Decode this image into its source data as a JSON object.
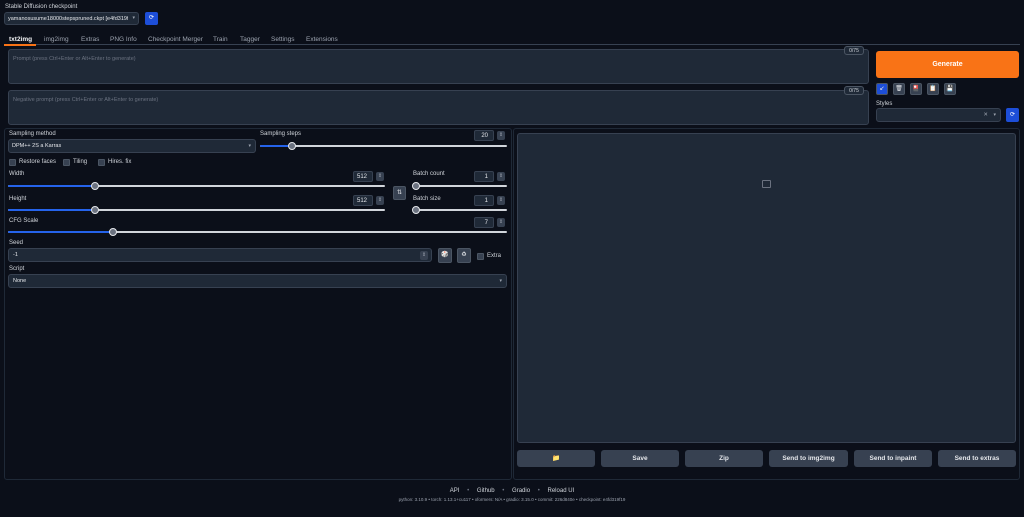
{
  "checkpoint": {
    "label": "Stable Diffusion checkpoint",
    "value": "yamanosusume18000stepspruned.ckpt [e4fd319f]"
  },
  "tabs": [
    "txt2img",
    "img2img",
    "Extras",
    "PNG Info",
    "Checkpoint Merger",
    "Train",
    "Tagger",
    "Settings",
    "Extensions"
  ],
  "prompt": {
    "placeholder": "Prompt (press Ctrl+Enter or Alt+Enter to generate)",
    "tokens": "0/75"
  },
  "negative_prompt": {
    "placeholder": "Negative prompt (press Ctrl+Enter or Alt+Enter to generate)",
    "tokens": "0/75"
  },
  "generate_label": "Generate",
  "styles_label": "Styles",
  "sampling_method": {
    "label": "Sampling method",
    "value": "DPM++ 2S a Karras"
  },
  "sampling_steps": {
    "label": "Sampling steps",
    "value": "20",
    "fraction": 0.13
  },
  "checkboxes": {
    "restore_faces": "Restore faces",
    "tiling": "Tiling",
    "hires_fix": "Hires. fix"
  },
  "width": {
    "label": "Width",
    "value": "512",
    "fraction": 0.23
  },
  "height": {
    "label": "Height",
    "value": "512",
    "fraction": 0.23
  },
  "batch_count": {
    "label": "Batch count",
    "value": "1",
    "fraction": 0.0
  },
  "batch_size": {
    "label": "Batch size",
    "value": "1",
    "fraction": 0.0
  },
  "cfg_scale": {
    "label": "CFG Scale",
    "value": "7",
    "fraction": 0.21
  },
  "seed": {
    "label": "Seed",
    "value": "-1",
    "extra_label": "Extra"
  },
  "script": {
    "label": "Script",
    "value": "None"
  },
  "output_buttons": [
    "Save",
    "Zip",
    "Send to img2img",
    "Send to inpaint",
    "Send to extras"
  ],
  "footer": {
    "links": [
      "API",
      "Github",
      "Gradio",
      "Reload UI"
    ],
    "sep": "•",
    "versions": "python: 3.10.9  •  torch: 1.13.1+cu117  •  xformers: N/A  •  gradio: 3.15.0  •  commit: 226d840e  •  checkpoint: e4fd319f19"
  },
  "colors": {
    "accent": "#f97316",
    "blue": "#2563eb",
    "background": "#0b0f19",
    "panel": "#1f2937"
  }
}
